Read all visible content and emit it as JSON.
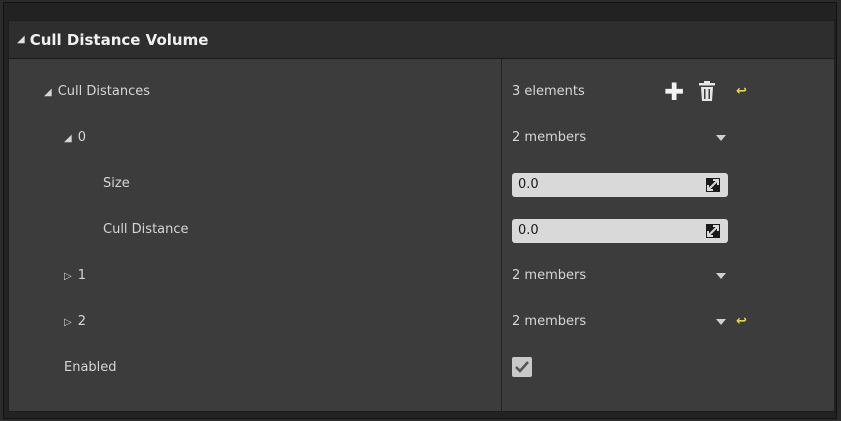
{
  "section": {
    "title": "Cull Distance Volume"
  },
  "cull_distances": {
    "label": "Cull Distances",
    "count_text": "3 elements",
    "elements": [
      {
        "index": "0",
        "summary": "2 members",
        "size": {
          "label": "Size",
          "value": "0.0"
        },
        "cull_distance": {
          "label": "Cull Distance",
          "value": "0.0"
        }
      },
      {
        "index": "1",
        "summary": "2 members"
      },
      {
        "index": "2",
        "summary": "2 members"
      }
    ]
  },
  "enabled": {
    "label": "Enabled",
    "checked": true
  },
  "colors": {
    "reset_accent": "#e6d83a",
    "panel_bg": "#3c3c3c",
    "header_bg": "#2e2e2e"
  },
  "icons": {
    "add": "plus-icon",
    "delete": "trash-icon",
    "reset": "reset-to-default-icon",
    "expand_open": "triangle-down-icon",
    "expand_closed": "triangle-right-icon",
    "dropdown": "chevron-down-icon",
    "drag": "drag-handle-icon",
    "check": "checkmark-icon"
  }
}
